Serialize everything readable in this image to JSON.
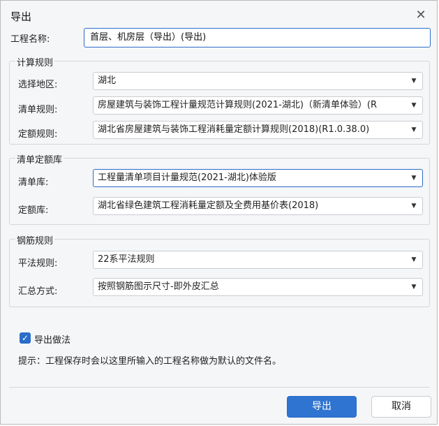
{
  "dialog": {
    "title": "导出",
    "close_glyph": "✕"
  },
  "project_name": {
    "label": "工程名称:",
    "value": "首层、机房层（导出）(导出)"
  },
  "calc_rules": {
    "title": "计算规则",
    "region_label": "选择地区:",
    "region_value": "湖北",
    "list_rule_label": "清单规则:",
    "list_rule_value": "房屋建筑与装饰工程计量规范计算规则(2021-湖北)（新清单体验）(R",
    "quota_rule_label": "定额规则:",
    "quota_rule_value": "湖北省房屋建筑与装饰工程消耗量定额计算规则(2018)(R1.0.38.0)"
  },
  "quota_library": {
    "title": "清单定额库",
    "list_lib_label": "清单库:",
    "list_lib_value": "工程量清单项目计量规范(2021-湖北)体验版",
    "quota_lib_label": "定额库:",
    "quota_lib_value": "湖北省绿色建筑工程消耗量定额及全费用基价表(2018)"
  },
  "rebar_rules": {
    "title": "钢筋规则",
    "flat_rule_label": "平法规则:",
    "flat_rule_value": "22系平法规则",
    "summary_label": "汇总方式:",
    "summary_value": "按照钢筋图示尺寸-即外皮汇总"
  },
  "export_method": {
    "checked": true,
    "label": "导出做法"
  },
  "hint": "提示：工程保存时会以这里所输入的工程名称做为默认的文件名。",
  "buttons": {
    "export": "导出",
    "cancel": "取消"
  },
  "icons": {
    "dropdown": "chevron-down-icon",
    "close": "close-icon",
    "check": "checkmark-icon"
  },
  "colors": {
    "accent": "#2f74d0",
    "focus_border": "#2a6dc9"
  }
}
